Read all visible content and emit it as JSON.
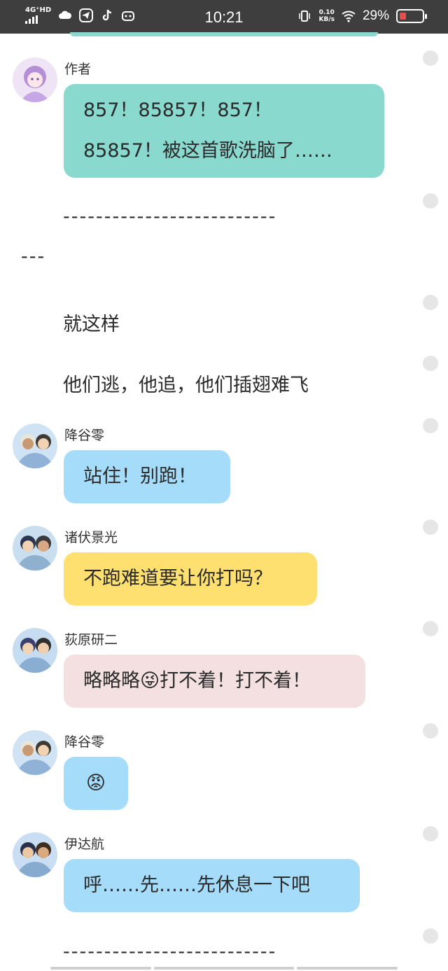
{
  "status_bar": {
    "network": "4G⁺HD",
    "time": "10:21",
    "speed_value": "0.10",
    "speed_unit": "KB/s",
    "battery": "29%",
    "icons": [
      "signal-icon",
      "cloud-icon",
      "telegram-icon",
      "tiktok-icon",
      "bilibili-icon",
      "vibrate-icon",
      "wifi-icon",
      "battery-icon"
    ]
  },
  "messages": [
    {
      "sender": "作者",
      "lines": [
        "857！85857！857！",
        "85857！被这首歌洗脑了……"
      ],
      "color": "#8ad9cf"
    },
    {
      "sender": "降谷零",
      "lines": [
        "站住！别跑！"
      ],
      "color": "#a5dcfa"
    },
    {
      "sender": "诸伏景光",
      "lines": [
        "不跑难道要让你打吗？"
      ],
      "color": "#fde070"
    },
    {
      "sender": "荻原研二",
      "pre": "略略略",
      "emoji": "😜",
      "post": "打不着！打不着！",
      "color": "#f4e0e0"
    },
    {
      "sender": "降谷零",
      "emoji": "😡",
      "color": "#a5dcfa"
    },
    {
      "sender": "伊达航",
      "lines": [
        "呼……先……先休息一下吧"
      ],
      "color": "#a5dcfa"
    }
  ],
  "narration": {
    "dashes_line1": "--------------------------",
    "dashes_line2": "---",
    "line1": "就这样",
    "line2": "他们逃，他追，他们插翅难飞",
    "dashes_bottom": "--------------------------"
  }
}
